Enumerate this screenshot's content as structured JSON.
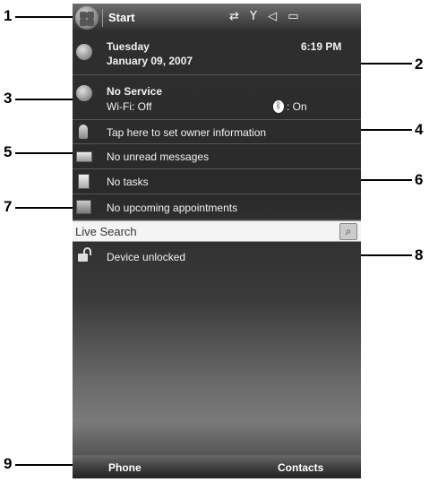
{
  "callouts": [
    "1",
    "2",
    "3",
    "4",
    "5",
    "6",
    "7",
    "8",
    "9"
  ],
  "titlebar": {
    "start_label": "Start",
    "status_icons": "⇄ Y ◁ ▭"
  },
  "date": {
    "weekday": "Tuesday",
    "date": "January 09, 2007",
    "time": "6:19 PM"
  },
  "connectivity": {
    "service": "No Service",
    "wifi": "Wi-Fi: Off",
    "bluetooth": ": On"
  },
  "owner": {
    "text": "Tap here to set owner information"
  },
  "messages": {
    "text": "No unread messages"
  },
  "tasks": {
    "text": "No tasks"
  },
  "appointments": {
    "text": "No upcoming appointments"
  },
  "search": {
    "value": "Live Search"
  },
  "lock": {
    "text": "Device unlocked"
  },
  "softkeys": {
    "left": "Phone",
    "right": "Contacts"
  }
}
